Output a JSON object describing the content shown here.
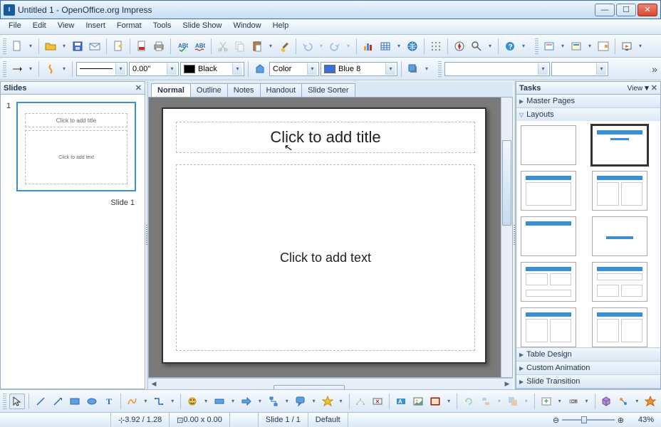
{
  "window": {
    "title": "Untitled 1 - OpenOffice.org Impress"
  },
  "menubar": [
    "File",
    "Edit",
    "View",
    "Insert",
    "Format",
    "Tools",
    "Slide Show",
    "Window",
    "Help"
  ],
  "toolbar2": {
    "width": "0.00\"",
    "color1_label": "Black",
    "fillmode": "Color",
    "color2_label": "Blue 8"
  },
  "viewtabs": [
    "Normal",
    "Outline",
    "Notes",
    "Handout",
    "Slide Sorter"
  ],
  "active_viewtab": "Normal",
  "slidespanel": {
    "title": "Slides",
    "slide_num": "1",
    "thumb_title": "Click to add title",
    "thumb_text": "Click to add text",
    "slide_label": "Slide 1"
  },
  "editor": {
    "title_placeholder": "Click to add title",
    "content_placeholder": "Click to add text"
  },
  "taskpanel": {
    "title": "Tasks",
    "viewlink": "View",
    "sections": {
      "master_pages": "Master Pages",
      "layouts": "Layouts",
      "table_design": "Table Design",
      "custom_animation": "Custom Animation",
      "slide_transition": "Slide Transition"
    }
  },
  "statusbar": {
    "pos": "3.92 / 1.28",
    "size": "0.00 x 0.00",
    "slide": "Slide 1 / 1",
    "style": "Default",
    "zoom": "43%"
  }
}
